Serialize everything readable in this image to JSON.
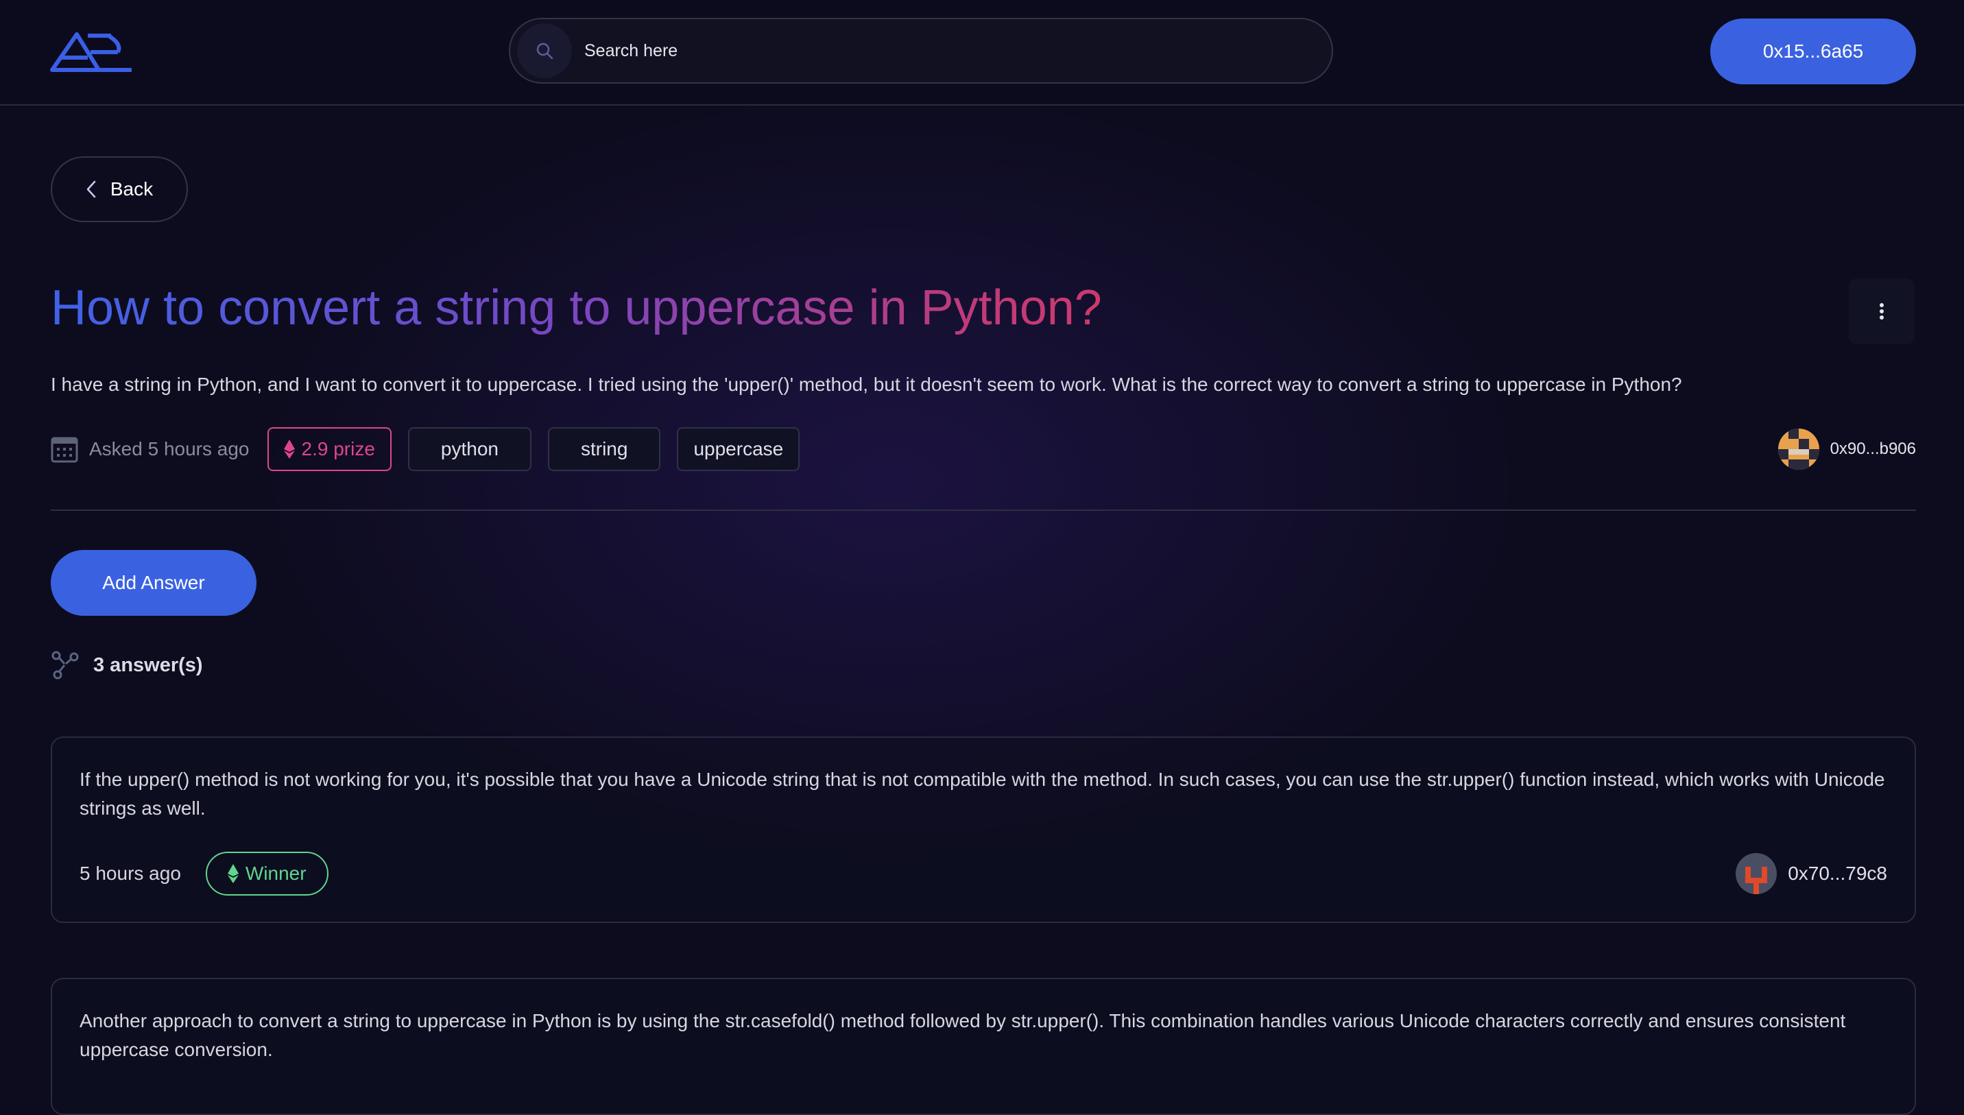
{
  "header": {
    "search_placeholder": "Search here",
    "wallet_label": "0x15...6a65"
  },
  "nav": {
    "back_label": "Back"
  },
  "question": {
    "title": "How to convert a string to uppercase in Python?",
    "body": "I have a string in Python, and I want to convert it to uppercase. I tried using the 'upper()' method, but it doesn't seem to work. What is the correct way to convert a string to uppercase in Python?",
    "asked": "Asked 5 hours ago",
    "prize": "2.9 prize",
    "tags": [
      "python",
      "string",
      "uppercase"
    ],
    "author": "0x90...b906"
  },
  "actions": {
    "add_answer_label": "Add Answer"
  },
  "answers_count": "3 answer(s)",
  "answers": [
    {
      "text": "If the upper() method is not working for you, it's possible that you have a Unicode string that is not compatible with the method. In such cases, you can use the str.upper() function instead, which works with Unicode strings as well.",
      "time": "5 hours ago",
      "badge": "Winner",
      "author": "0x70...79c8"
    },
    {
      "text": "Another approach to convert a string to uppercase in Python is by using the str.casefold() method followed by str.upper(). This combination handles various Unicode characters correctly and ensures consistent uppercase conversion."
    }
  ],
  "colors": {
    "accent": "#3a62e0",
    "prize": "#e0458c",
    "winner": "#5fd68c",
    "title_gradient": [
      "#3f63e8",
      "#7a47c0",
      "#c23a78",
      "#d23a64"
    ]
  },
  "icons": [
    "logo-icon",
    "search-icon",
    "chevron-left-icon",
    "more-vertical-icon",
    "calendar-icon",
    "ethereum-icon",
    "share-nodes-icon"
  ]
}
